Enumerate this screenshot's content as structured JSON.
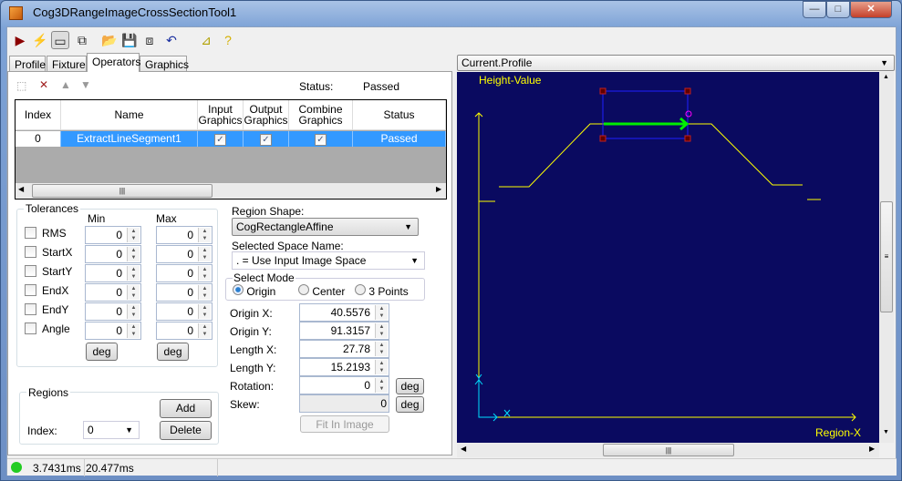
{
  "window": {
    "title": "Cog3DRangeImageCrossSectionTool1",
    "minimize": "—",
    "maximize": "□",
    "close": "✕"
  },
  "toolbar": [
    {
      "icon": "run-icon",
      "glyph": "▶",
      "color": "#8b0000"
    },
    {
      "icon": "electric-icon",
      "glyph": "⚡",
      "color": "#d4c000"
    },
    {
      "icon": "show-display-icon",
      "glyph": "▭"
    },
    {
      "icon": "floating-display-icon",
      "glyph": "⧉"
    },
    {
      "icon": "open-folder-icon",
      "glyph": "📂"
    },
    {
      "icon": "save-icon",
      "glyph": "💾"
    },
    {
      "icon": "save-as-icon",
      "glyph": "⧈"
    },
    {
      "icon": "reset-icon",
      "glyph": "↶",
      "color": "#1a2fa0"
    },
    {
      "icon": "setup-icon",
      "glyph": "⊿",
      "color": "#b0a000"
    },
    {
      "icon": "help-icon",
      "glyph": "?",
      "color": "#d4b000"
    }
  ],
  "tabs": [
    {
      "label": "Profile"
    },
    {
      "label": "Fixture"
    },
    {
      "label": "Operators",
      "active": true
    },
    {
      "label": "Graphics"
    }
  ],
  "operators": {
    "status_label": "Status:",
    "status_value": "Passed",
    "columns": [
      "Index",
      "Name",
      "Input Graphics",
      "Output Graphics",
      "Combine Graphics",
      "Status"
    ],
    "rows": [
      {
        "index": "0",
        "name": "ExtractLineSegment1",
        "input_graphics": true,
        "output_graphics": true,
        "combine_graphics": true,
        "status": "Passed"
      }
    ]
  },
  "tolerances": {
    "title": "Tolerances",
    "min_label": "Min",
    "max_label": "Max",
    "items": [
      {
        "label": "RMS",
        "min": "0",
        "max": "0"
      },
      {
        "label": "StartX",
        "min": "0",
        "max": "0"
      },
      {
        "label": "StartY",
        "min": "0",
        "max": "0"
      },
      {
        "label": "EndX",
        "min": "0",
        "max": "0"
      },
      {
        "label": "EndY",
        "min": "0",
        "max": "0"
      },
      {
        "label": "Angle",
        "min": "0",
        "max": "0"
      }
    ],
    "deg_min": "deg",
    "deg_max": "deg"
  },
  "regions": {
    "title": "Regions",
    "add": "Add",
    "delete": "Delete",
    "index_label": "Index:",
    "index_value": "0"
  },
  "region": {
    "shape_label": "Region Shape:",
    "shape_value": "CogRectangleAffine",
    "space_label": "Selected Space Name:",
    "space_value": ". = Use Input Image Space",
    "mode_label": "Select Mode",
    "modes": [
      "Origin",
      "Center",
      "3 Points"
    ],
    "selected_mode": "Origin",
    "fields": [
      {
        "label": "Origin X:",
        "value": "40.5576"
      },
      {
        "label": "Origin Y:",
        "value": "91.3157"
      },
      {
        "label": "Length X:",
        "value": "27.78"
      },
      {
        "label": "Length Y:",
        "value": "15.2193"
      },
      {
        "label": "Rotation:",
        "value": "0"
      },
      {
        "label": "Skew:",
        "value": "0"
      }
    ],
    "deg": "deg",
    "fit": "Fit In Image"
  },
  "display": {
    "selector": "Current.Profile",
    "y_label": "Height-Value",
    "x_label": "Region-X",
    "axis_x": "X",
    "axis_y": "Y",
    "background": "#0a0a60",
    "profile_color": "#ffff00",
    "arrow_color": "#00ee00"
  },
  "statusbar": {
    "time1": "3.7431ms",
    "time2": "20.477ms",
    "indicator_color": "#22cc22"
  }
}
